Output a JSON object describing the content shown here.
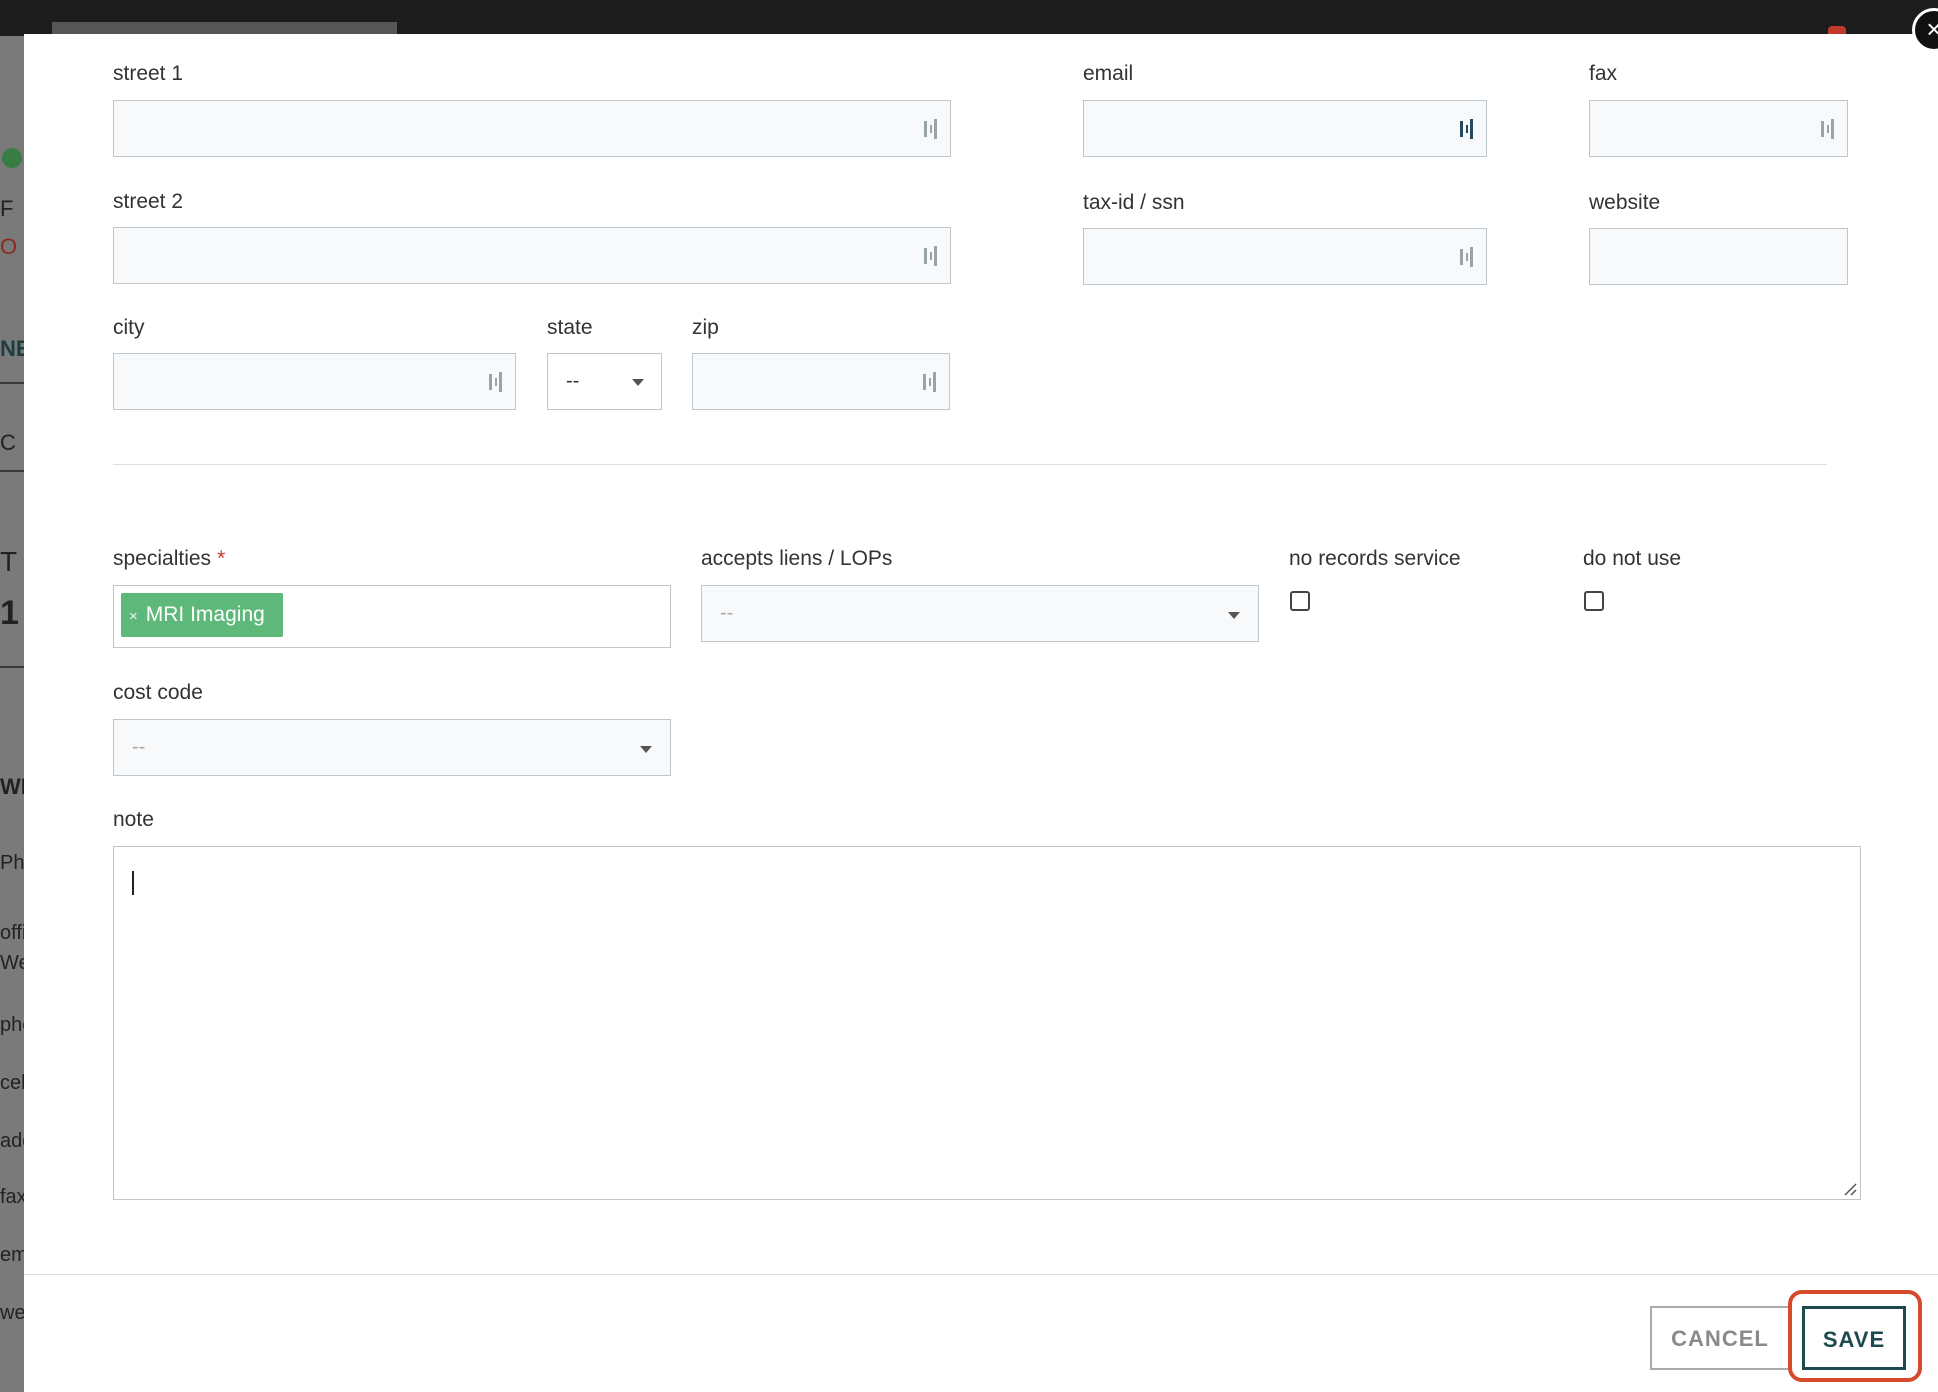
{
  "background": {
    "left_fragments": [
      "F",
      "O",
      "NE",
      "C",
      "T",
      "1",
      "WI",
      "Phy",
      "offi",
      "We",
      "pho",
      "cel",
      "add",
      "fax",
      "em",
      "we"
    ]
  },
  "modal": {
    "close_glyph": "×",
    "fields": {
      "street1": {
        "label": "street 1",
        "value": ""
      },
      "street2": {
        "label": "street 2",
        "value": ""
      },
      "city": {
        "label": "city",
        "value": ""
      },
      "state": {
        "label": "state",
        "value": "--"
      },
      "zip": {
        "label": "zip",
        "value": ""
      },
      "email": {
        "label": "email",
        "value": ""
      },
      "fax": {
        "label": "fax",
        "value": ""
      },
      "taxid": {
        "label": "tax-id / ssn",
        "value": ""
      },
      "website": {
        "label": "website",
        "value": ""
      },
      "specialties": {
        "label": "specialties",
        "required_mark": "*",
        "tags": [
          "MRI Imaging"
        ],
        "tag_remove_glyph": "×"
      },
      "accepts_liens": {
        "label": "accepts liens / LOPs",
        "value": "--"
      },
      "no_records_service": {
        "label": "no records service",
        "checked": false
      },
      "do_not_use": {
        "label": "do not use",
        "checked": false
      },
      "cost_code": {
        "label": "cost code",
        "value": "--"
      },
      "note": {
        "label": "note",
        "value": ""
      }
    },
    "buttons": {
      "cancel": "CANCEL",
      "save": "SAVE"
    }
  },
  "colors": {
    "tag": "#5db87a",
    "save": "#1d4a4f",
    "highlight": "#d64a2c",
    "required": "#c0392b"
  }
}
